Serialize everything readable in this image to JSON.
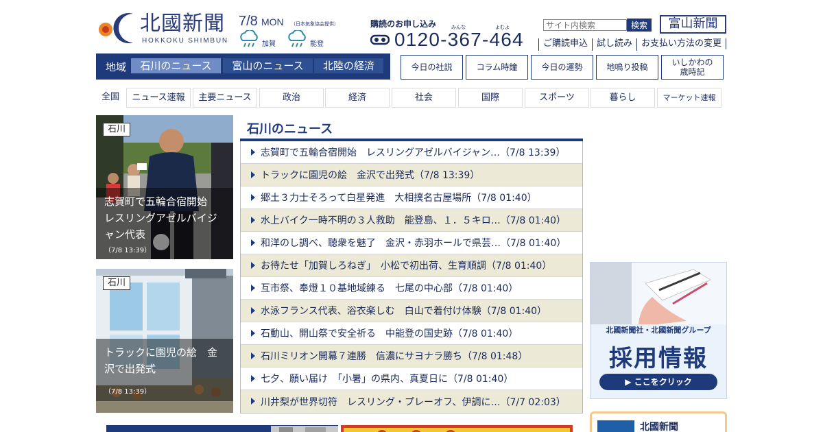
{
  "header": {
    "logo_text": "北國新聞",
    "logo_roman": "HOKKOKU SHIMBUN",
    "date": "7/8",
    "day_of_week": "MON",
    "weather_credit": "（日本気象協会提供）",
    "weather": [
      {
        "label": "加賀",
        "icon": "rain-icon"
      },
      {
        "label": "能登",
        "icon": "rain-icon"
      }
    ],
    "subscribe_label": "購読のお申し込み",
    "subscribe_ruby_1": "みんな",
    "subscribe_ruby_2": "よむよ",
    "phone": "0120-367-464",
    "search_placeholder": "サイト内検索",
    "search_button": "検索",
    "toyama_button": "富山新聞",
    "util_links": [
      "ご購読申込",
      "試し読み",
      "お支払い方法の変更"
    ]
  },
  "region_nav": {
    "label": "地域",
    "tabs": [
      "石川のニュース",
      "富山のニュース",
      "北陸の経済"
    ],
    "active": "石川のニュース"
  },
  "quick_buttons": [
    "今日の社説",
    "コラム時鐘",
    "今日の運勢",
    "地鳴り投稿",
    "いしかわの\n歳時記"
  ],
  "categories": {
    "all_label": "全国",
    "tabs": [
      "ニュース速報",
      "主要ニュース",
      "政治",
      "経済",
      "社会",
      "国際",
      "スポーツ",
      "暮らし",
      "マーケット速報"
    ]
  },
  "featured": [
    {
      "badge": "石川",
      "title": "志賀町で五輪合宿開始　レスリングアゼルバイジャン代表",
      "time": "（7/8 13:39）"
    },
    {
      "badge": "石川",
      "title": "トラックに園児の絵　金沢で出発式",
      "time": "（7/8 13:39）"
    }
  ],
  "news_section": {
    "title": "石川のニュース",
    "items": [
      "志賀町で五輪合宿開始　レスリングアゼルバイジャン…（7/8 13:39）",
      "トラックに園児の絵　金沢で出発式（7/8 13:39）",
      "郷土３力士そろって白星発進　大相撲名古屋場所（7/8 01:40）",
      "水上バイク一時不明の３人救助　能登島、１．５キロ…（7/8 01:40）",
      "和洋のし調べ、聴衆を魅了　金沢・赤羽ホールで県芸…（7/8 01:40）",
      "お待たせ「加賀しろねぎ」　小松で初出荷、生育順調（7/8 01:40）",
      "互市祭、奉燈１０基地域練る　七尾の中心部（7/8 01:40）",
      "水泳フランス代表、浴衣楽しむ　白山で着付け体験（7/8 01:40）",
      "石動山、開山祭で安全祈る　中能登の国史跡（7/8 01:40）",
      "石川ミリオン開幕７連勝　信濃にサヨナラ勝ち（7/8 01:48）",
      "七夕、願い届け　「小暑」の県内、真夏日に（7/8 01:40）",
      "川井梨が世界切符　レスリング・プレーオフ、伊調に…（7/7 02:03）"
    ]
  },
  "ad": {
    "company": "北國新聞社・北國新聞グループ",
    "title": "採用情報",
    "button": "▶ ここをクリック"
  },
  "promo": {
    "text": "北國新聞"
  }
}
